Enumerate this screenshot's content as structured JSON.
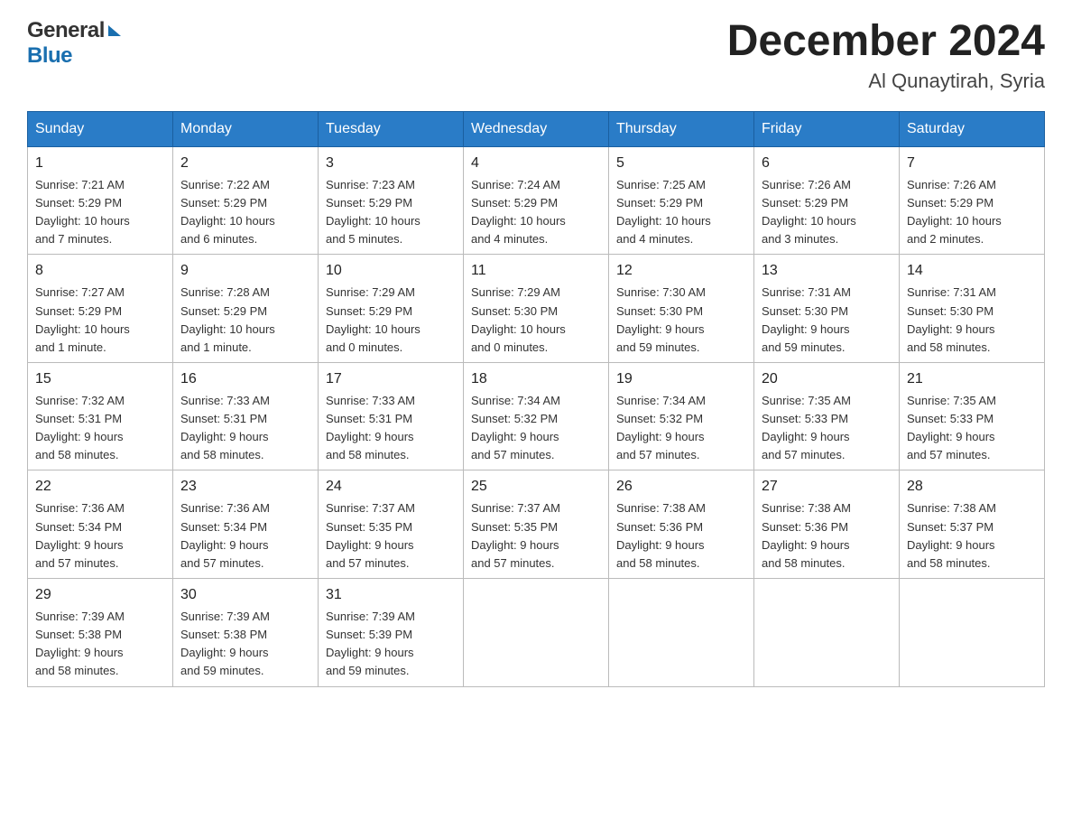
{
  "header": {
    "logo": {
      "general": "General",
      "blue": "Blue"
    },
    "title": "December 2024",
    "location": "Al Qunaytirah, Syria"
  },
  "calendar": {
    "headers": [
      "Sunday",
      "Monday",
      "Tuesday",
      "Wednesday",
      "Thursday",
      "Friday",
      "Saturday"
    ],
    "weeks": [
      [
        {
          "day": "1",
          "info": "Sunrise: 7:21 AM\nSunset: 5:29 PM\nDaylight: 10 hours\nand 7 minutes."
        },
        {
          "day": "2",
          "info": "Sunrise: 7:22 AM\nSunset: 5:29 PM\nDaylight: 10 hours\nand 6 minutes."
        },
        {
          "day": "3",
          "info": "Sunrise: 7:23 AM\nSunset: 5:29 PM\nDaylight: 10 hours\nand 5 minutes."
        },
        {
          "day": "4",
          "info": "Sunrise: 7:24 AM\nSunset: 5:29 PM\nDaylight: 10 hours\nand 4 minutes."
        },
        {
          "day": "5",
          "info": "Sunrise: 7:25 AM\nSunset: 5:29 PM\nDaylight: 10 hours\nand 4 minutes."
        },
        {
          "day": "6",
          "info": "Sunrise: 7:26 AM\nSunset: 5:29 PM\nDaylight: 10 hours\nand 3 minutes."
        },
        {
          "day": "7",
          "info": "Sunrise: 7:26 AM\nSunset: 5:29 PM\nDaylight: 10 hours\nand 2 minutes."
        }
      ],
      [
        {
          "day": "8",
          "info": "Sunrise: 7:27 AM\nSunset: 5:29 PM\nDaylight: 10 hours\nand 1 minute."
        },
        {
          "day": "9",
          "info": "Sunrise: 7:28 AM\nSunset: 5:29 PM\nDaylight: 10 hours\nand 1 minute."
        },
        {
          "day": "10",
          "info": "Sunrise: 7:29 AM\nSunset: 5:29 PM\nDaylight: 10 hours\nand 0 minutes."
        },
        {
          "day": "11",
          "info": "Sunrise: 7:29 AM\nSunset: 5:30 PM\nDaylight: 10 hours\nand 0 minutes."
        },
        {
          "day": "12",
          "info": "Sunrise: 7:30 AM\nSunset: 5:30 PM\nDaylight: 9 hours\nand 59 minutes."
        },
        {
          "day": "13",
          "info": "Sunrise: 7:31 AM\nSunset: 5:30 PM\nDaylight: 9 hours\nand 59 minutes."
        },
        {
          "day": "14",
          "info": "Sunrise: 7:31 AM\nSunset: 5:30 PM\nDaylight: 9 hours\nand 58 minutes."
        }
      ],
      [
        {
          "day": "15",
          "info": "Sunrise: 7:32 AM\nSunset: 5:31 PM\nDaylight: 9 hours\nand 58 minutes."
        },
        {
          "day": "16",
          "info": "Sunrise: 7:33 AM\nSunset: 5:31 PM\nDaylight: 9 hours\nand 58 minutes."
        },
        {
          "day": "17",
          "info": "Sunrise: 7:33 AM\nSunset: 5:31 PM\nDaylight: 9 hours\nand 58 minutes."
        },
        {
          "day": "18",
          "info": "Sunrise: 7:34 AM\nSunset: 5:32 PM\nDaylight: 9 hours\nand 57 minutes."
        },
        {
          "day": "19",
          "info": "Sunrise: 7:34 AM\nSunset: 5:32 PM\nDaylight: 9 hours\nand 57 minutes."
        },
        {
          "day": "20",
          "info": "Sunrise: 7:35 AM\nSunset: 5:33 PM\nDaylight: 9 hours\nand 57 minutes."
        },
        {
          "day": "21",
          "info": "Sunrise: 7:35 AM\nSunset: 5:33 PM\nDaylight: 9 hours\nand 57 minutes."
        }
      ],
      [
        {
          "day": "22",
          "info": "Sunrise: 7:36 AM\nSunset: 5:34 PM\nDaylight: 9 hours\nand 57 minutes."
        },
        {
          "day": "23",
          "info": "Sunrise: 7:36 AM\nSunset: 5:34 PM\nDaylight: 9 hours\nand 57 minutes."
        },
        {
          "day": "24",
          "info": "Sunrise: 7:37 AM\nSunset: 5:35 PM\nDaylight: 9 hours\nand 57 minutes."
        },
        {
          "day": "25",
          "info": "Sunrise: 7:37 AM\nSunset: 5:35 PM\nDaylight: 9 hours\nand 57 minutes."
        },
        {
          "day": "26",
          "info": "Sunrise: 7:38 AM\nSunset: 5:36 PM\nDaylight: 9 hours\nand 58 minutes."
        },
        {
          "day": "27",
          "info": "Sunrise: 7:38 AM\nSunset: 5:36 PM\nDaylight: 9 hours\nand 58 minutes."
        },
        {
          "day": "28",
          "info": "Sunrise: 7:38 AM\nSunset: 5:37 PM\nDaylight: 9 hours\nand 58 minutes."
        }
      ],
      [
        {
          "day": "29",
          "info": "Sunrise: 7:39 AM\nSunset: 5:38 PM\nDaylight: 9 hours\nand 58 minutes."
        },
        {
          "day": "30",
          "info": "Sunrise: 7:39 AM\nSunset: 5:38 PM\nDaylight: 9 hours\nand 59 minutes."
        },
        {
          "day": "31",
          "info": "Sunrise: 7:39 AM\nSunset: 5:39 PM\nDaylight: 9 hours\nand 59 minutes."
        },
        null,
        null,
        null,
        null
      ]
    ]
  }
}
